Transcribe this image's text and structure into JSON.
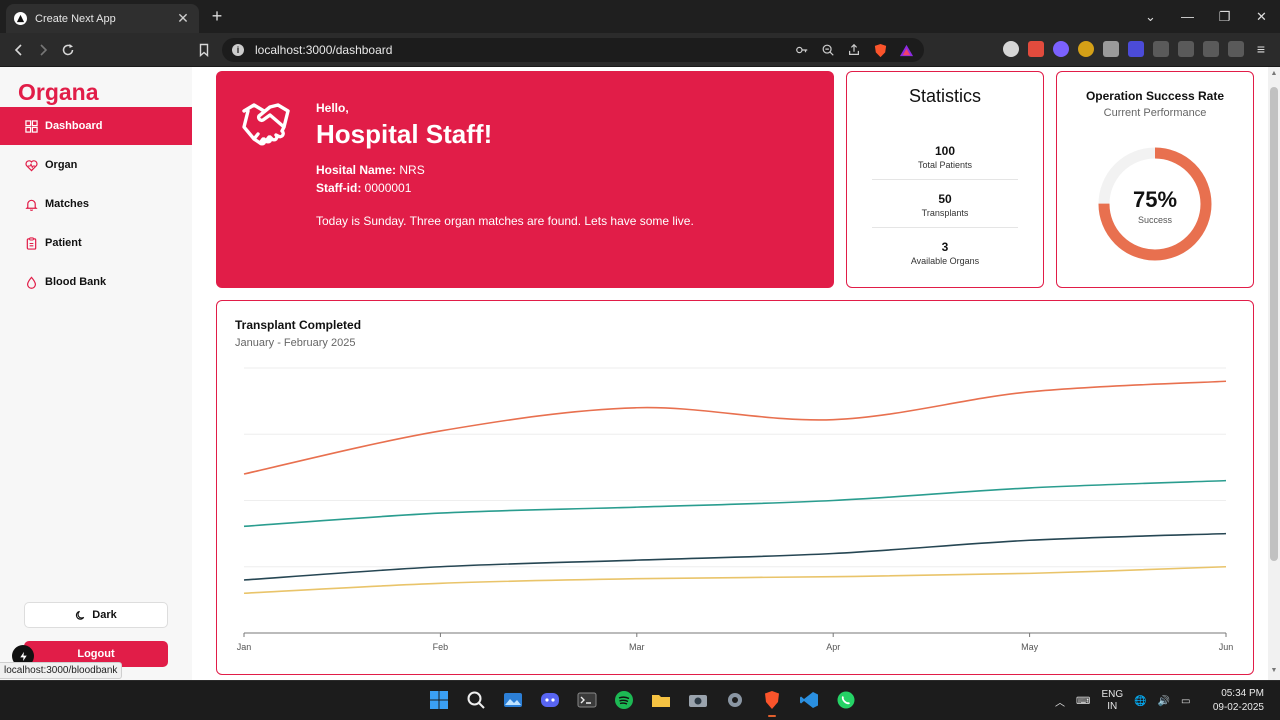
{
  "browser": {
    "tab_title": "Create Next App",
    "url": "localhost:3000/dashboard",
    "status_url": "localhost:3000/bloodbank"
  },
  "sidebar": {
    "brand": "Organa",
    "items": [
      {
        "label": "Dashboard",
        "icon": "grid-icon",
        "active": true
      },
      {
        "label": "Organ",
        "icon": "heart-pulse-icon"
      },
      {
        "label": "Matches",
        "icon": "bell-icon"
      },
      {
        "label": "Patient",
        "icon": "clipboard-icon"
      },
      {
        "label": "Blood Bank",
        "icon": "droplet-icon"
      }
    ],
    "dark_label": "Dark",
    "logout_label": "Logout"
  },
  "welcome": {
    "hello": "Hello,",
    "title": "Hospital Staff!",
    "hospital_label": "Hosital Name:",
    "hospital_value": "NRS",
    "staff_label": "Staff-id:",
    "staff_value": "0000001",
    "message": "Today is Sunday. Three organ matches are found. Lets have some live."
  },
  "statistics": {
    "title": "Statistics",
    "items": [
      {
        "value": "100",
        "label": "Total Patients"
      },
      {
        "value": "50",
        "label": "Transplants"
      },
      {
        "value": "3",
        "label": "Available Organs"
      }
    ]
  },
  "success_rate": {
    "title": "Operation Success Rate",
    "subtitle": "Current Performance",
    "value_text": "75%",
    "value": 0.75,
    "label": "Success",
    "color": "#e8704f"
  },
  "chart_data": {
    "type": "line",
    "title": "Transplant Completed",
    "subtitle": "January - February 2025",
    "categories": [
      "Jan",
      "Feb",
      "Mar",
      "Apr",
      "May",
      "Jun"
    ],
    "xlabel": "",
    "ylabel": "",
    "ylim": [
      0,
      400
    ],
    "grid": true,
    "legend": "none",
    "series": [
      {
        "color": "#e8704f",
        "values": [
          240,
          305,
          340,
          322,
          364,
          380
        ]
      },
      {
        "color": "#2a9d8f",
        "values": [
          161,
          181,
          190,
          200,
          219,
          230
        ]
      },
      {
        "color": "#264653",
        "values": [
          80,
          100,
          110,
          120,
          140,
          150
        ]
      },
      {
        "color": "#e9c46a",
        "values": [
          60,
          75,
          82,
          85,
          90,
          100
        ]
      }
    ]
  },
  "taskbar": {
    "lang_line1": "ENG",
    "lang_line2": "IN",
    "time": "05:34 PM",
    "date": "09-02-2025"
  }
}
